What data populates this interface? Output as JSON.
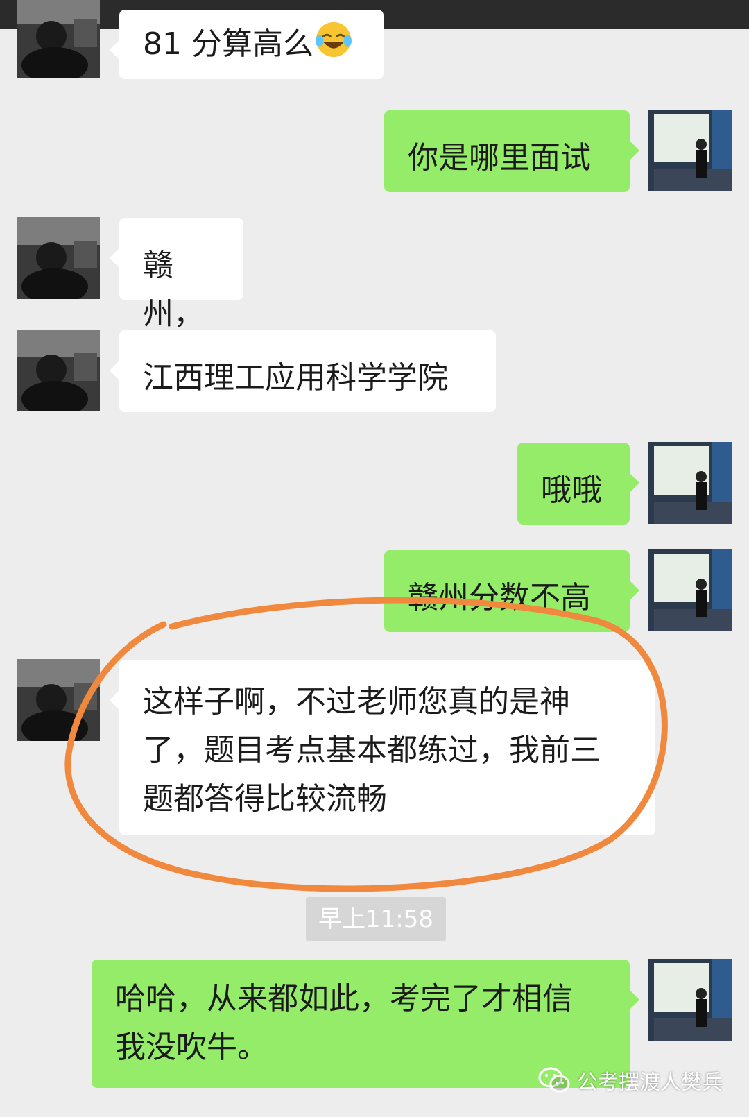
{
  "messages": [
    {
      "side": "left",
      "text": "81 分算高么",
      "emoji": "tears-of-joy-emoji"
    },
    {
      "side": "right",
      "text": "你是哪里面试"
    },
    {
      "side": "left",
      "text": "赣州，"
    },
    {
      "side": "left",
      "text": "江西理工应用科学学院"
    },
    {
      "side": "right",
      "text": "哦哦"
    },
    {
      "side": "right",
      "text": "赣州分数不高"
    },
    {
      "side": "left",
      "text": "这样子啊，不过老师您真的是神\n了，题目考点基本都练过，我前三\n题都答得比较流畅"
    },
    {
      "side": "right",
      "text": "哈哈，从来都如此，考完了才相信\n我没吹牛。"
    }
  ],
  "timestamp": "早上11:58",
  "annotation": {
    "color": "#f0883e",
    "shape": "hand-drawn-circle"
  },
  "watermark": {
    "text": "公考摆渡人樊兵",
    "icon": "wechat-icon"
  },
  "colors": {
    "background": "#ededed",
    "self_bubble": "#95ec69",
    "other_bubble": "#ffffff",
    "topbar": "#2b2b2b"
  }
}
